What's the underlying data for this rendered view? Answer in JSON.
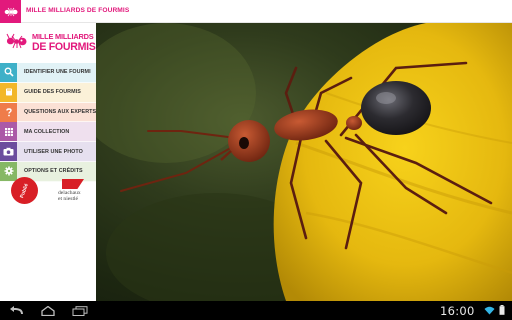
{
  "app": {
    "title": "MILLE MILLIARDS DE FOURMIS",
    "brand_color": "#e2197c"
  },
  "logo": {
    "line1": "MILLE MILLIARDS",
    "line2": "DE FOURMIS",
    "icon": "ant-logo-icon"
  },
  "menu": {
    "items": [
      {
        "label": "IDENTIFIER UNE FOURMI",
        "icon": "search-icon",
        "color": "#3eb0c8"
      },
      {
        "label": "GUIDE DES FOURMIS",
        "icon": "book-icon",
        "color": "#f2b729"
      },
      {
        "label": "QUESTIONS AUX EXPERTS",
        "icon": "question-icon",
        "color": "#ef7c4a"
      },
      {
        "label": "MA COLLECTION",
        "icon": "grid-icon",
        "color": "#ab5aa7"
      },
      {
        "label": "UTILISER UNE PHOTO",
        "icon": "camera-icon",
        "color": "#6c4d9e"
      },
      {
        "label": "OPTIONS ET CRÉDITS",
        "icon": "gear-icon",
        "color": "#86b865"
      }
    ]
  },
  "partners": {
    "publisher1": "Publié",
    "publisher2_line1": "delachaux",
    "publisher2_line2": "et niestlé"
  },
  "carousel": {
    "page_count": 7,
    "active_index": 2
  },
  "system": {
    "time": "16:00",
    "nav_icons": [
      "back-icon",
      "home-icon",
      "recent-apps-icon"
    ],
    "status_icons": [
      "wifi-icon",
      "battery-icon"
    ]
  }
}
